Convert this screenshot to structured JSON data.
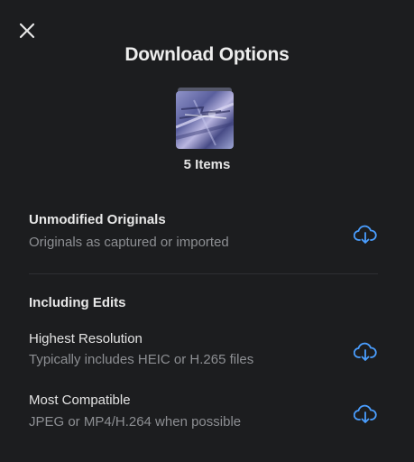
{
  "dialog": {
    "title": "Download Options",
    "close_icon": "close-icon",
    "thumbnail_icon": "photo-stack-thumbnail",
    "items_count": "5 Items"
  },
  "options": {
    "unmodified": {
      "title": "Unmodified Originals",
      "subtitle": "Originals as captured or imported",
      "icon": "cloud-download-icon"
    },
    "section_heading": "Including Edits",
    "highest": {
      "title": "Highest Resolution",
      "subtitle": "Typically includes HEIC or H.265 files",
      "icon": "cloud-download-icon"
    },
    "compatible": {
      "title": "Most Compatible",
      "subtitle": "JPEG or MP4/H.264 when possible",
      "icon": "cloud-download-icon"
    }
  },
  "colors": {
    "background": "#1c1d1f",
    "accent": "#4a9eff",
    "primary_text": "#e8e8e8",
    "secondary_text": "#8d8f93"
  }
}
